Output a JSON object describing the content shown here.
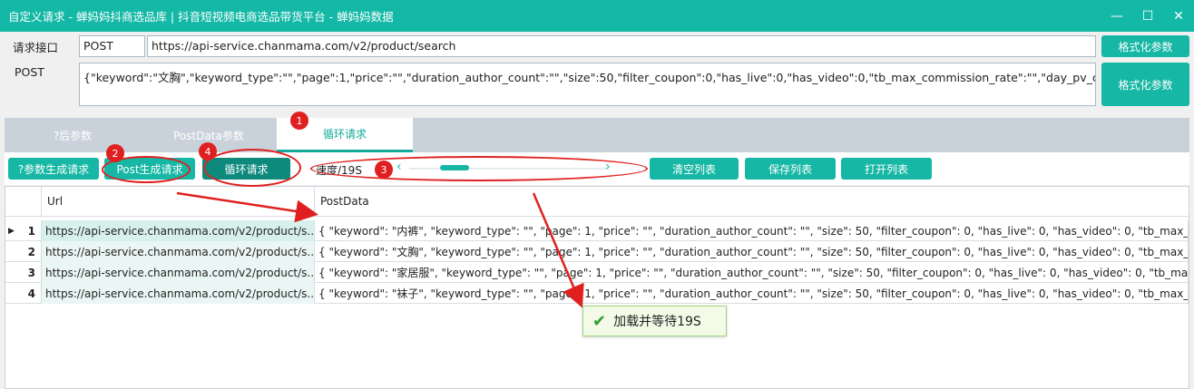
{
  "window": {
    "title": "自定义请求 - 蝉妈妈抖商选品库 | 抖音短视频电商选品带货平台 - 蝉妈妈数据",
    "controls": {
      "minimize": "—",
      "maximize": "☐",
      "close": "✕"
    }
  },
  "request": {
    "endpoint_label": "请求接口",
    "method": "POST",
    "url": "https://api-service.chanmama.com/v2/product/search",
    "format_label_1": "格式化参数",
    "post_label": "POST",
    "post_body": "{\"keyword\":\"文胸\",\"keyword_type\":\"\",\"page\":1,\"price\":\"\",\"duration_author_count\":\"\",\"size\":50,\"filter_coupon\":0,\"has_live\":0,\"has_video\":0,\"tb_max_commission_rate\":\"\",\"day_pv_count\":\"\",\"duration_vo",
    "format_label_2": "格式化参数"
  },
  "tabs": [
    "?后参数",
    "PostData参数",
    "循环请求"
  ],
  "active_tab": 2,
  "toolbar": {
    "gen_query_btn": "?参数生成请求",
    "gen_post_btn": "Post生成请求",
    "loop_btn": "循环请求",
    "speed_label": "速度/19S",
    "speed_level": 0.18,
    "clear_btn": "清空列表",
    "save_btn": "保存列表",
    "open_btn": "打开列表"
  },
  "table": {
    "headers": [
      "Url",
      "PostData"
    ],
    "rows": [
      {
        "num": "1",
        "url": "https://api-service.chanmama.com/v2/product/s...",
        "data": "{  \"keyword\": \"内裤\",  \"keyword_type\": \"\",  \"page\": 1,  \"price\": \"\",  \"duration_author_count\": \"\",  \"size\": 50,  \"filter_coupon\": 0,  \"has_live\": 0,  \"has_video\": 0,  \"tb_max_c..."
      },
      {
        "num": "2",
        "url": "https://api-service.chanmama.com/v2/product/s...",
        "data": "{  \"keyword\": \"文胸\",  \"keyword_type\": \"\",  \"page\": 1,  \"price\": \"\",  \"duration_author_count\": \"\",  \"size\": 50,  \"filter_coupon\": 0,  \"has_live\": 0,  \"has_video\": 0,  \"tb_max_c..."
      },
      {
        "num": "3",
        "url": "https://api-service.chanmama.com/v2/product/s...",
        "data": "{  \"keyword\": \"家居服\",  \"keyword_type\": \"\",  \"page\": 1,  \"price\": \"\",  \"duration_author_count\": \"\",  \"size\": 50,  \"filter_coupon\": 0,  \"has_live\": 0,  \"has_video\": 0,  \"tb_max..."
      },
      {
        "num": "4",
        "url": "https://api-service.chanmama.com/v2/product/s...",
        "data": "{  \"keyword\": \"袜子\",  \"keyword_type\": \"\",  \"page\": 1,  \"price\": \"\",  \"duration_author_count\": \"\",  \"size\": 50,  \"filter_coupon\": 0,  \"has_live\": 0,  \"has_video\": 0,  \"tb_max_c..."
      }
    ]
  },
  "toast": {
    "text": "加载并等待19S",
    "icon": "check-icon"
  },
  "annotations": [
    "1",
    "2",
    "3",
    "4"
  ],
  "colors": {
    "accent": "#16b7a4",
    "annotation": "#e02020"
  }
}
